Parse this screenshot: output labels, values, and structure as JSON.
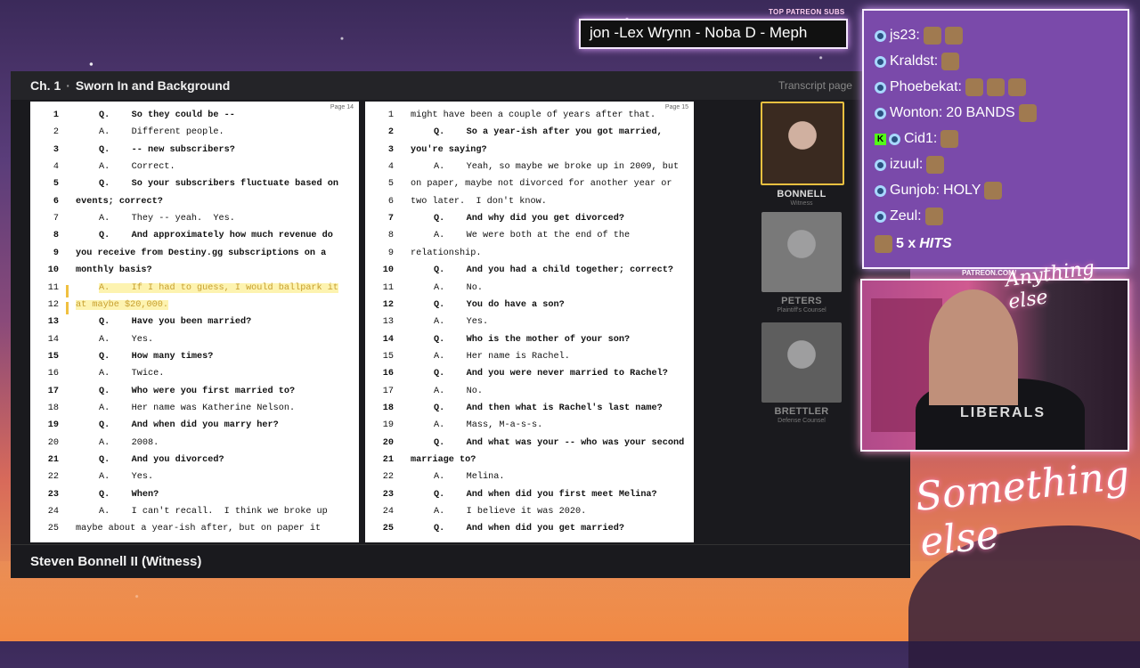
{
  "chapter": {
    "number": "Ch. 1",
    "separator": "·",
    "title": "Sworn In and Background"
  },
  "transcript_page_label": "Transcript page",
  "footer_label": "Steven Bonnell II (Witness)",
  "page_left": {
    "page_label": "Page 14",
    "lines": [
      {
        "n": "1",
        "t": "Q.    So they could be --",
        "b": true
      },
      {
        "n": "2",
        "t": "A.    Different people.",
        "b": false
      },
      {
        "n": "3",
        "t": "Q.    -- new subscribers?",
        "b": true
      },
      {
        "n": "4",
        "t": "A.    Correct.",
        "b": false
      },
      {
        "n": "5",
        "t": "Q.    So your subscribers fluctuate based on",
        "b": true
      },
      {
        "n": "6",
        "t": "events; correct?",
        "b": true,
        "flush": true
      },
      {
        "n": "7",
        "t": "A.    They -- yeah.  Yes.",
        "b": false
      },
      {
        "n": "8",
        "t": "Q.    And approximately how much revenue do",
        "b": true
      },
      {
        "n": "9",
        "t": "you receive from Destiny.gg subscriptions on a",
        "b": true,
        "flush": true
      },
      {
        "n": "10",
        "t": "monthly basis?",
        "b": true,
        "flush": true
      },
      {
        "n": "11",
        "t": "A.    If I had to guess, I would ballpark it",
        "b": false,
        "hl": true
      },
      {
        "n": "12",
        "t": "at maybe $20,000.",
        "b": false,
        "flush": true,
        "hl": true
      },
      {
        "n": "13",
        "t": "Q.    Have you been married?",
        "b": true
      },
      {
        "n": "14",
        "t": "A.    Yes.",
        "b": false
      },
      {
        "n": "15",
        "t": "Q.    How many times?",
        "b": true
      },
      {
        "n": "16",
        "t": "A.    Twice.",
        "b": false
      },
      {
        "n": "17",
        "t": "Q.    Who were you first married to?",
        "b": true
      },
      {
        "n": "18",
        "t": "A.    Her name was Katherine Nelson.",
        "b": false
      },
      {
        "n": "19",
        "t": "Q.    And when did you marry her?",
        "b": true
      },
      {
        "n": "20",
        "t": "A.    2008.",
        "b": false
      },
      {
        "n": "21",
        "t": "Q.    And you divorced?",
        "b": true
      },
      {
        "n": "22",
        "t": "A.    Yes.",
        "b": false
      },
      {
        "n": "23",
        "t": "Q.    When?",
        "b": true
      },
      {
        "n": "24",
        "t": "A.    I can't recall.  I think we broke up",
        "b": false
      },
      {
        "n": "25",
        "t": "maybe about a year-ish after, but on paper it",
        "b": false,
        "flush": true
      }
    ]
  },
  "page_right": {
    "page_label": "Page 15",
    "lines": [
      {
        "n": "1",
        "t": "might have been a couple of years after that.",
        "b": false,
        "flush": true
      },
      {
        "n": "2",
        "t": "Q.    So a year-ish after you got married,",
        "b": true
      },
      {
        "n": "3",
        "t": "you're saying?",
        "b": true,
        "flush": true
      },
      {
        "n": "4",
        "t": "A.    Yeah, so maybe we broke up in 2009, but",
        "b": false
      },
      {
        "n": "5",
        "t": "on paper, maybe not divorced for another year or",
        "b": false,
        "flush": true
      },
      {
        "n": "6",
        "t": "two later.  I don't know.",
        "b": false,
        "flush": true
      },
      {
        "n": "7",
        "t": "Q.    And why did you get divorced?",
        "b": true
      },
      {
        "n": "8",
        "t": "A.    We were both at the end of the",
        "b": false
      },
      {
        "n": "9",
        "t": "relationship.",
        "b": false,
        "flush": true
      },
      {
        "n": "10",
        "t": "Q.    And you had a child together; correct?",
        "b": true
      },
      {
        "n": "11",
        "t": "A.    No.",
        "b": false
      },
      {
        "n": "12",
        "t": "Q.    You do have a son?",
        "b": true
      },
      {
        "n": "13",
        "t": "A.    Yes.",
        "b": false
      },
      {
        "n": "14",
        "t": "Q.    Who is the mother of your son?",
        "b": true
      },
      {
        "n": "15",
        "t": "A.    Her name is Rachel.",
        "b": false
      },
      {
        "n": "16",
        "t": "Q.    And you were never married to Rachel?",
        "b": true
      },
      {
        "n": "17",
        "t": "A.    No.",
        "b": false
      },
      {
        "n": "18",
        "t": "Q.    And then what is Rachel's last name?",
        "b": true
      },
      {
        "n": "19",
        "t": "A.    Mass, M-a-s-s.",
        "b": false
      },
      {
        "n": "20",
        "t": "Q.    And what was your -- who was your second",
        "b": true
      },
      {
        "n": "21",
        "t": "marriage to?",
        "b": true,
        "flush": true
      },
      {
        "n": "22",
        "t": "A.    Melina.",
        "b": false
      },
      {
        "n": "23",
        "t": "Q.    And when did you first meet Melina?",
        "b": true
      },
      {
        "n": "24",
        "t": "A.    I believe it was 2020.",
        "b": false
      },
      {
        "n": "25",
        "t": "Q.    And when did you get married?",
        "b": true
      }
    ]
  },
  "participants": [
    {
      "name": "BONNELL",
      "role": "Witness",
      "active": true,
      "photo_color": "#3a2a20"
    },
    {
      "name": "PETERS",
      "role": "Plaintiff's Counsel",
      "active": false,
      "photo_color": "#8a8a8a"
    },
    {
      "name": "BRETTLER",
      "role": "Defense Counsel",
      "active": false,
      "photo_color": "#6a6a6a"
    }
  ],
  "subs": {
    "label": "TOP PATREON SUBS",
    "ticker": "jon -Lex Wrynn -  Noba D - Meph"
  },
  "chat": [
    {
      "user": "js23:",
      "msg": "",
      "emotes": 2,
      "color": "#ffffff"
    },
    {
      "user": "Kraldst:",
      "msg": "",
      "emotes": 1,
      "color": "#ffffff"
    },
    {
      "user": "Phoebekat:",
      "msg": "",
      "emotes": 3,
      "color": "#ffffff"
    },
    {
      "user": "Wonton:",
      "msg": "20 BANDS",
      "emotes": 1,
      "color": "#ffffff"
    },
    {
      "user": "Cid1:",
      "msg": "",
      "emotes": 1,
      "color": "#ffffff",
      "kick": true
    },
    {
      "user": "izuul:",
      "msg": "",
      "emotes": 1,
      "color": "#ffffff"
    },
    {
      "user": "Gunjob:",
      "msg": "HOLY",
      "emotes": 1,
      "color": "#ffffff"
    },
    {
      "user": "Zeul:",
      "msg": "",
      "emotes": 1,
      "color": "#ffffff"
    }
  ],
  "hits": {
    "count": "5 x",
    "label": "HITS"
  },
  "patreon_label": "PATREON.COM/",
  "cam_shirt": "LIBERALS",
  "script_top": "Anything else",
  "script_bottom": "Something else",
  "accent_colors": {
    "active_border": "#e8c040",
    "chat_bg": "#7a4aaa",
    "highlight": "#fdf3b0"
  }
}
